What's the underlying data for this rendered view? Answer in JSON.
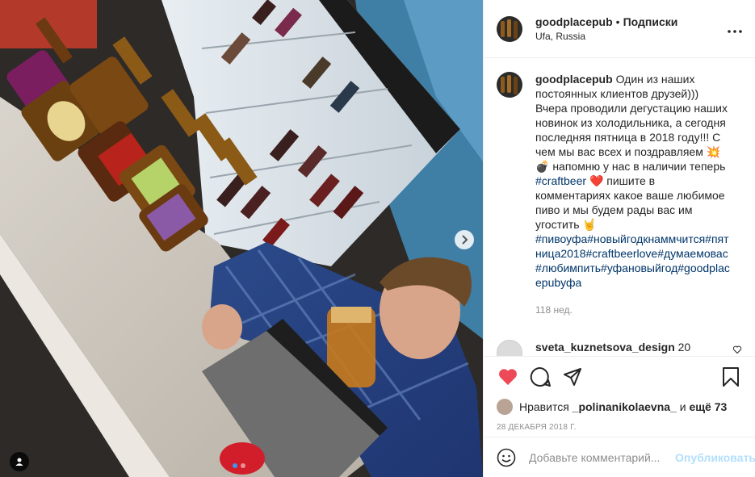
{
  "post": {
    "username": "goodplacepub",
    "separator": "•",
    "follow_label": "Подписки",
    "location": "Ufa, Russia",
    "more_icon": "more-horizontal-icon"
  },
  "caption": {
    "username": "goodplacepub",
    "text_1": "Один из наших постоянных клиентов друзей))) Вчера проводили дегустацию наших новинок из холодильника, а сегодня последняя пятница в 2018 году!!! С чем мы вас всех и поздравляем 💥 💣 напомню у нас в наличии теперь",
    "tag_craftbeer": "#craftbeer",
    "text_2": "❤️ пишите в комментариях какое ваше любимое пиво и мы будем рады вас им угостить 🤘",
    "hashtags": "#пивоуфа#новыйгодкнаммчится#пятница2018#craftbeerlove#думаемовас#любимпить#уфановыйгод#goodplacepubуфа",
    "time": "118 нед."
  },
  "comment": {
    "username": "sveta_kuznetsova_design",
    "text": "20"
  },
  "likes": {
    "prefix": "Нравится",
    "user": "_polinanikolaevna_",
    "middle": "и",
    "others": "ещё 73"
  },
  "date": "28 ДЕКАБРЯ 2018 Г.",
  "add_comment": {
    "placeholder": "Добавьте комментарий...",
    "post_label": "Опубликовать"
  },
  "colors": {
    "like_red": "#ed4956",
    "link_blue": "#003569",
    "post_disabled": "#b2dffc"
  }
}
